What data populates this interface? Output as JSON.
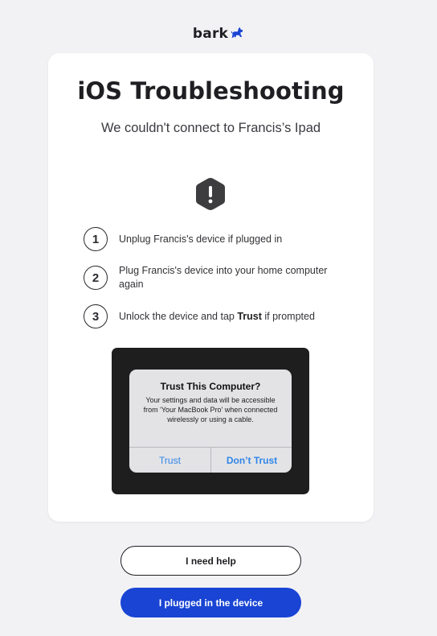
{
  "brand": {
    "name": "bark",
    "accent_color": "#1944d4"
  },
  "card": {
    "title": "iOS Troubleshooting",
    "subtitle": "We couldn't connect to Francis’s Ipad",
    "alert_icon": "exclamation-hexagon-icon"
  },
  "steps": [
    {
      "number": "1",
      "text": "Unplug Francis's device if plugged in"
    },
    {
      "number": "2",
      "text": "Plug Francis's device into your home computer again"
    },
    {
      "number": "3",
      "text_before": "Unlock the device and tap ",
      "text_bold": "Trust",
      "text_after": " if prompted"
    }
  ],
  "dialog": {
    "title": "Trust This Computer?",
    "body": "Your settings and data will be accessible from 'Your MacBook Pro' when connected wirelessly or using a cable.",
    "trust_label": "Trust",
    "dont_trust_label": "Don’t Trust"
  },
  "actions": {
    "help_label": "I need help",
    "plugged_label": "I plugged in the device"
  }
}
